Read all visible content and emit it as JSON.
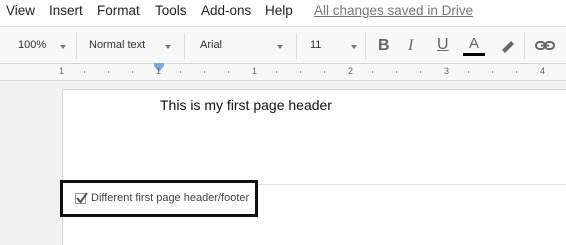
{
  "menu": {
    "items": [
      "View",
      "Insert",
      "Format",
      "Tools",
      "Add-ons",
      "Help"
    ],
    "save_status": "All changes saved in Drive"
  },
  "toolbar": {
    "zoom": "100%",
    "style": "Normal text",
    "font": "Arial",
    "size": "11",
    "bold_icon": "B",
    "italic_icon": "I",
    "underline_icon": "U",
    "text_color_icon": "A",
    "text_color": "#000000"
  },
  "ruler": {
    "labels": [
      "1",
      "1",
      "1",
      "2",
      "3",
      "4"
    ]
  },
  "document": {
    "header_text": "This is my first page header"
  },
  "header_options": {
    "different_first_page_label": "Different first page header/footer",
    "different_first_page_checked": true
  }
}
